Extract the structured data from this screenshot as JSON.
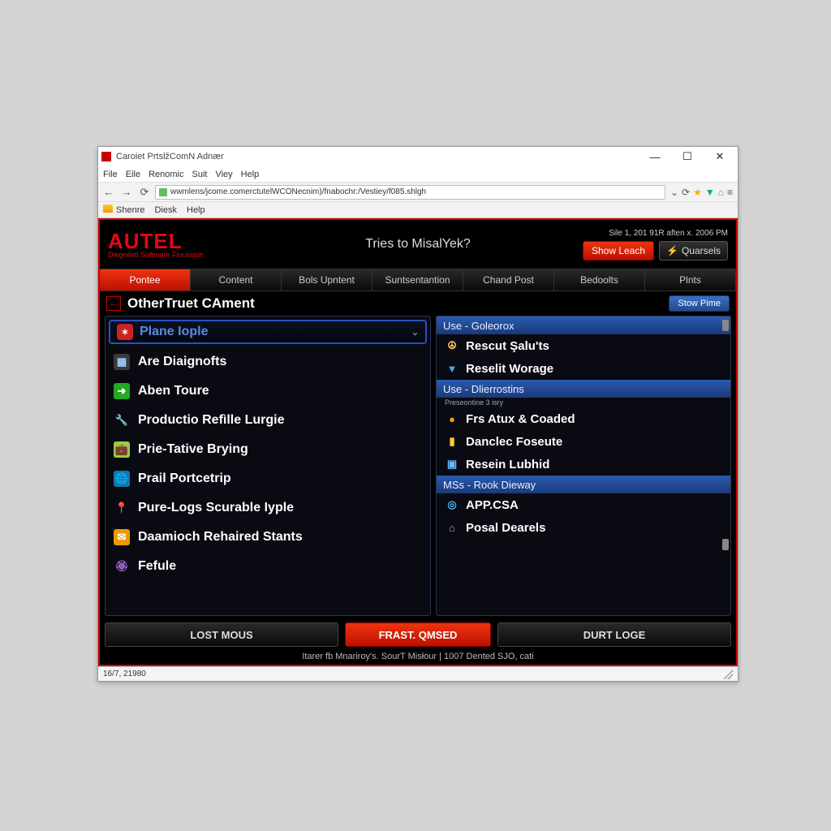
{
  "window": {
    "title": "Caroiet PrtslžComN Adnær"
  },
  "menubar": [
    "File",
    "Eile",
    "Renomic",
    "Suit",
    "Viey",
    "Help"
  ],
  "url": "wwmlens/jcome.comerctutelWCONecnim)/fnabochr:/Vestiey/f085.shlgh",
  "bookmarks": [
    "Shenre",
    "Diesk",
    "Help"
  ],
  "header": {
    "logo": "AUTEL",
    "logo_sub": "Diegnesti Softmare Floussion",
    "center": "Tries to MisalYek?",
    "date": "Sile 1, 201 91R aften x. 2006 PM",
    "btn_show": "Show Leach",
    "btn_quarsels": "Quarsels"
  },
  "tabs": [
    "Pontee",
    "Content",
    "Bols Upntent",
    "Suntsentantion",
    "Chand Post",
    "Bedoolts",
    "Plnts"
  ],
  "section": {
    "title": "OtherTruet CAment",
    "btn_stow": "Stow Pime"
  },
  "dropdown": {
    "selected": "Plane Iople"
  },
  "left_items": [
    {
      "icon": "grid",
      "icon_bg": "#3a3a3a",
      "icon_color": "#9cf",
      "label": "Are Diaignofts"
    },
    {
      "icon": "arrow",
      "icon_bg": "#2a2",
      "icon_color": "#fff",
      "label": "Aben Toure"
    },
    {
      "icon": "wrench",
      "icon_bg": "transparent",
      "icon_color": "#ccc",
      "label": "Productio Refìlle Lurgie"
    },
    {
      "icon": "case",
      "icon_bg": "#9c4",
      "icon_color": "#fff",
      "label": "Prie-Tative Brying"
    },
    {
      "icon": "globe",
      "icon_bg": "#17a",
      "icon_color": "#fff",
      "label": "Prail Portcetrip"
    },
    {
      "icon": "pin",
      "icon_bg": "transparent",
      "icon_color": "#f55",
      "label": "Pure-Logs Scurable Iyple"
    },
    {
      "icon": "mail",
      "icon_bg": "#e90",
      "icon_color": "#fff",
      "label": "Daamioch Rehaired Stants"
    },
    {
      "icon": "ribbon",
      "icon_bg": "transparent",
      "icon_color": "#96c",
      "label": "Fefule"
    }
  ],
  "right_groups": [
    {
      "header": "Use - Goleorox",
      "items": [
        {
          "icon": "☮",
          "color": "#fc6",
          "label": "Rescut Şalu'ts"
        },
        {
          "icon": "▼",
          "color": "#4ae",
          "label": "Reselit Worage"
        }
      ]
    },
    {
      "header": "Use - Dlierrostins",
      "sub": "Preseontine 3 isry",
      "items": [
        {
          "icon": "●",
          "color": "#f90",
          "label": "Frs Atux & Coaded"
        },
        {
          "icon": "▮",
          "color": "#fc3",
          "label": "Danclec Foseute"
        },
        {
          "icon": "▣",
          "color": "#6bf",
          "label": "Resein Lubhid"
        }
      ]
    },
    {
      "header": "MSs - Rook Dieway",
      "items": [
        {
          "icon": "◎",
          "color": "#4bf",
          "label": "APP.CSA"
        },
        {
          "icon": "⌂",
          "color": "#aaa",
          "label": "Posal Dearels"
        }
      ]
    }
  ],
  "bottom": {
    "lost": "LOST MOUS",
    "frast": "FRAST. QMSED",
    "durt": "DURT LOGE"
  },
  "footer": "Itarer fb Mnariroy's. SourT Misłour | 1007 Dented SJO, cati",
  "status": "16/7, 21980"
}
